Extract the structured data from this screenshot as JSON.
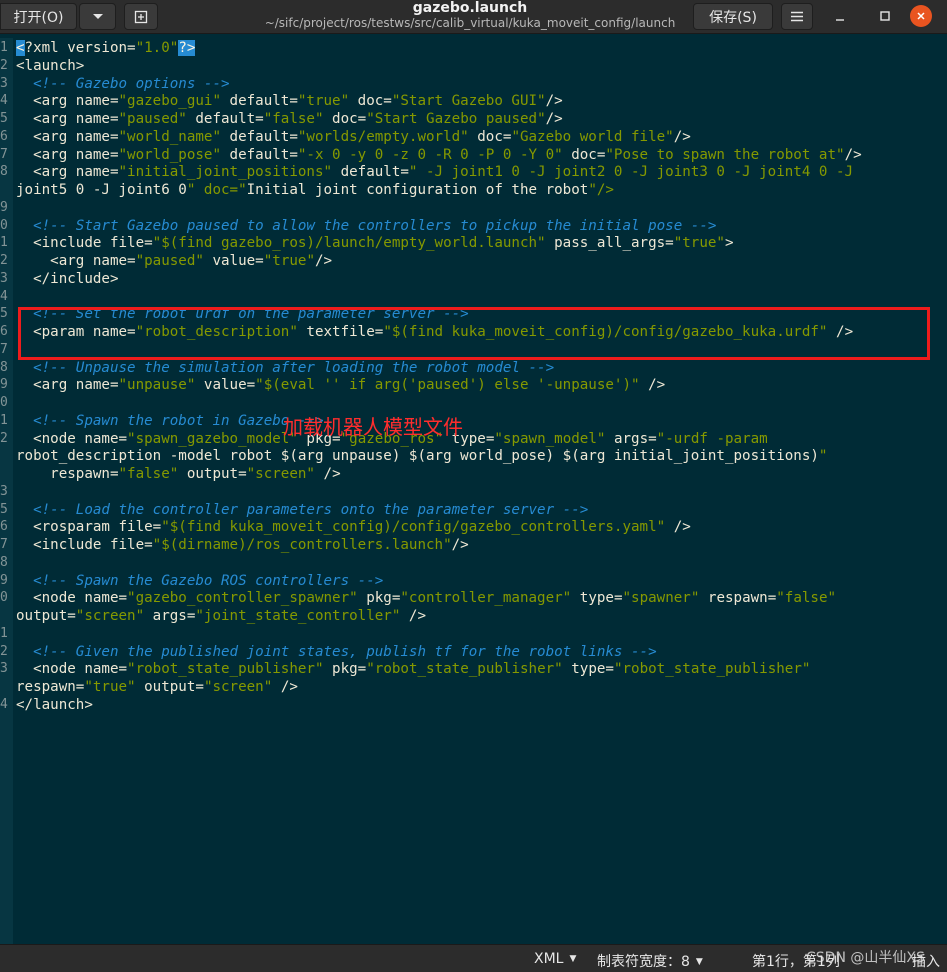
{
  "window": {
    "title": "gazebo.launch",
    "subtitle": "~/sifc/project/ros/testws/src/calib_virtual/kuka_moveit_config/launch"
  },
  "header": {
    "open_label": "打开(O)",
    "open_menu_icon": "chevron-down-icon",
    "new_tab_icon": "new-document-icon",
    "save_label": "保存(S)",
    "menu_icon": "hamburger-icon",
    "minimize_icon": "minimize-icon",
    "maximize_icon": "maximize-icon",
    "close_icon": "close-icon"
  },
  "editor": {
    "lines": [
      {
        "ln": "1",
        "code": "<?xml version=\"1.0\"?>"
      },
      {
        "ln": "2",
        "code": "<launch>"
      },
      {
        "ln": "3",
        "code": "  <!-- Gazebo options -->"
      },
      {
        "ln": "4",
        "code": "  <arg name=\"gazebo_gui\" default=\"true\" doc=\"Start Gazebo GUI\"/>"
      },
      {
        "ln": "5",
        "code": "  <arg name=\"paused\" default=\"false\" doc=\"Start Gazebo paused\"/>"
      },
      {
        "ln": "6",
        "code": "  <arg name=\"world_name\" default=\"worlds/empty.world\" doc=\"Gazebo world file\"/>"
      },
      {
        "ln": "7",
        "code": "  <arg name=\"world_pose\" default=\"-x 0 -y 0 -z 0 -R 0 -P 0 -Y 0\" doc=\"Pose to spawn the robot at\"/>"
      },
      {
        "ln": "8",
        "code": "  <arg name=\"initial_joint_positions\" default=\" -J joint1 0 -J joint2 0 -J joint3 0 -J joint4 0 -J"
      },
      {
        "ln": "",
        "code": "joint5 0 -J joint6 0\" doc=\"Initial joint configuration of the robot\"/>"
      },
      {
        "ln": "9",
        "code": ""
      },
      {
        "ln": "0",
        "code": "  <!-- Start Gazebo paused to allow the controllers to pickup the initial pose -->"
      },
      {
        "ln": "1",
        "code": "  <include file=\"$(find gazebo_ros)/launch/empty_world.launch\" pass_all_args=\"true\">"
      },
      {
        "ln": "2",
        "code": "    <arg name=\"paused\" value=\"true\"/>"
      },
      {
        "ln": "3",
        "code": "  </include>"
      },
      {
        "ln": "4",
        "code": ""
      },
      {
        "ln": "5",
        "code": "  <!-- Set the robot urdf on the parameter server -->"
      },
      {
        "ln": "6",
        "code": "  <param name=\"robot_description\" textfile=\"$(find kuka_moveit_config)/config/gazebo_kuka.urdf\" />"
      },
      {
        "ln": "7",
        "code": ""
      },
      {
        "ln": "8",
        "code": "  <!-- Unpause the simulation after loading the robot model -->"
      },
      {
        "ln": "9",
        "code": "  <arg name=\"unpause\" value=\"$(eval '' if arg('paused') else '-unpause')\" />"
      },
      {
        "ln": "0",
        "code": ""
      },
      {
        "ln": "1",
        "code": "  <!-- Spawn the robot in Gazebo -->"
      },
      {
        "ln": "2",
        "code": "  <node name=\"spawn_gazebo_model\" pkg=\"gazebo_ros\" type=\"spawn_model\" args=\"-urdf -param"
      },
      {
        "ln": "",
        "code": "robot_description -model robot $(arg unpause) $(arg world_pose) $(arg initial_joint_positions)\""
      },
      {
        "ln": "",
        "code": "    respawn=\"false\" output=\"screen\" />"
      },
      {
        "ln": "3",
        "code": ""
      },
      {
        "ln": "5",
        "code": "  <!-- Load the controller parameters onto the parameter server -->"
      },
      {
        "ln": "6",
        "code": "  <rosparam file=\"$(find kuka_moveit_config)/config/gazebo_controllers.yaml\" />"
      },
      {
        "ln": "7",
        "code": "  <include file=\"$(dirname)/ros_controllers.launch\"/>"
      },
      {
        "ln": "8",
        "code": ""
      },
      {
        "ln": "9",
        "code": "  <!-- Spawn the Gazebo ROS controllers -->"
      },
      {
        "ln": "0",
        "code": "  <node name=\"gazebo_controller_spawner\" pkg=\"controller_manager\" type=\"spawner\" respawn=\"false\""
      },
      {
        "ln": "",
        "code": "output=\"screen\" args=\"joint_state_controller\" />"
      },
      {
        "ln": "1",
        "code": ""
      },
      {
        "ln": "2",
        "code": "  <!-- Given the published joint states, publish tf for the robot links -->"
      },
      {
        "ln": "3",
        "code": "  <node name=\"robot_state_publisher\" pkg=\"robot_state_publisher\" type=\"robot_state_publisher\""
      },
      {
        "ln": "",
        "code": "respawn=\"true\" output=\"screen\" />"
      },
      {
        "ln": "4",
        "code": "</launch>"
      }
    ],
    "annotation": "加载机器人模型文件"
  },
  "statusbar": {
    "language": "XML",
    "tab_width": "制表符宽度：8",
    "position": "第1行，第1列",
    "insert_mode": "插入"
  },
  "watermark": "CSDN @山半仙XS",
  "colors": {
    "background": "#002b36",
    "highlight_box": "#ee1c1c",
    "annotation": "#ff2d2d",
    "close_button": "#e95420"
  }
}
